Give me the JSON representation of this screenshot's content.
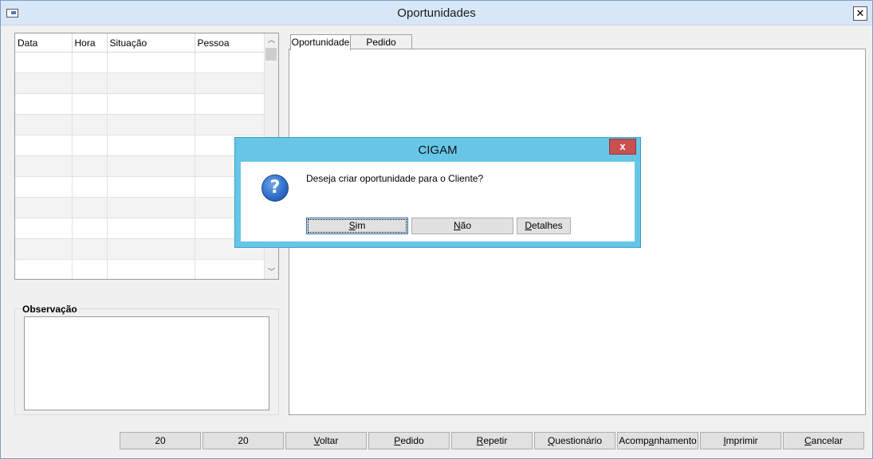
{
  "window": {
    "title": "Oportunidades"
  },
  "grid": {
    "columns": [
      "Data",
      "Hora",
      "Situação",
      "Pessoa"
    ],
    "row_count": 11
  },
  "observacao": {
    "label": "Observação"
  },
  "tabs": [
    {
      "label": "Oportunidade",
      "active": true
    },
    {
      "label": "Pedido",
      "active": false
    }
  ],
  "buttons": [
    {
      "pre": "",
      "ul": "",
      "post": "20"
    },
    {
      "pre": "",
      "ul": "",
      "post": "20"
    },
    {
      "pre": "",
      "ul": "V",
      "post": "oltar"
    },
    {
      "pre": "",
      "ul": "P",
      "post": "edido"
    },
    {
      "pre": "",
      "ul": "R",
      "post": "epetir"
    },
    {
      "pre": "",
      "ul": "Q",
      "post": "uestionário"
    },
    {
      "pre": "Acomp",
      "ul": "a",
      "post": "nhamento"
    },
    {
      "pre": "",
      "ul": "I",
      "post": "mprimir"
    },
    {
      "pre": "",
      "ul": "C",
      "post": "ancelar"
    }
  ],
  "dialog": {
    "title": "CIGAM",
    "close": "x",
    "message": "Deseja criar oportunidade para o Cliente?",
    "icon": "question-icon",
    "buttons": [
      {
        "ul": "S",
        "post": "im"
      },
      {
        "ul": "N",
        "post": "ão"
      },
      {
        "ul": "D",
        "post": "etalhes"
      }
    ]
  },
  "colors": {
    "dialog_frame": "#67c6e8",
    "dialog_close": "#c75050",
    "titlebar": "#d8e7f7"
  }
}
